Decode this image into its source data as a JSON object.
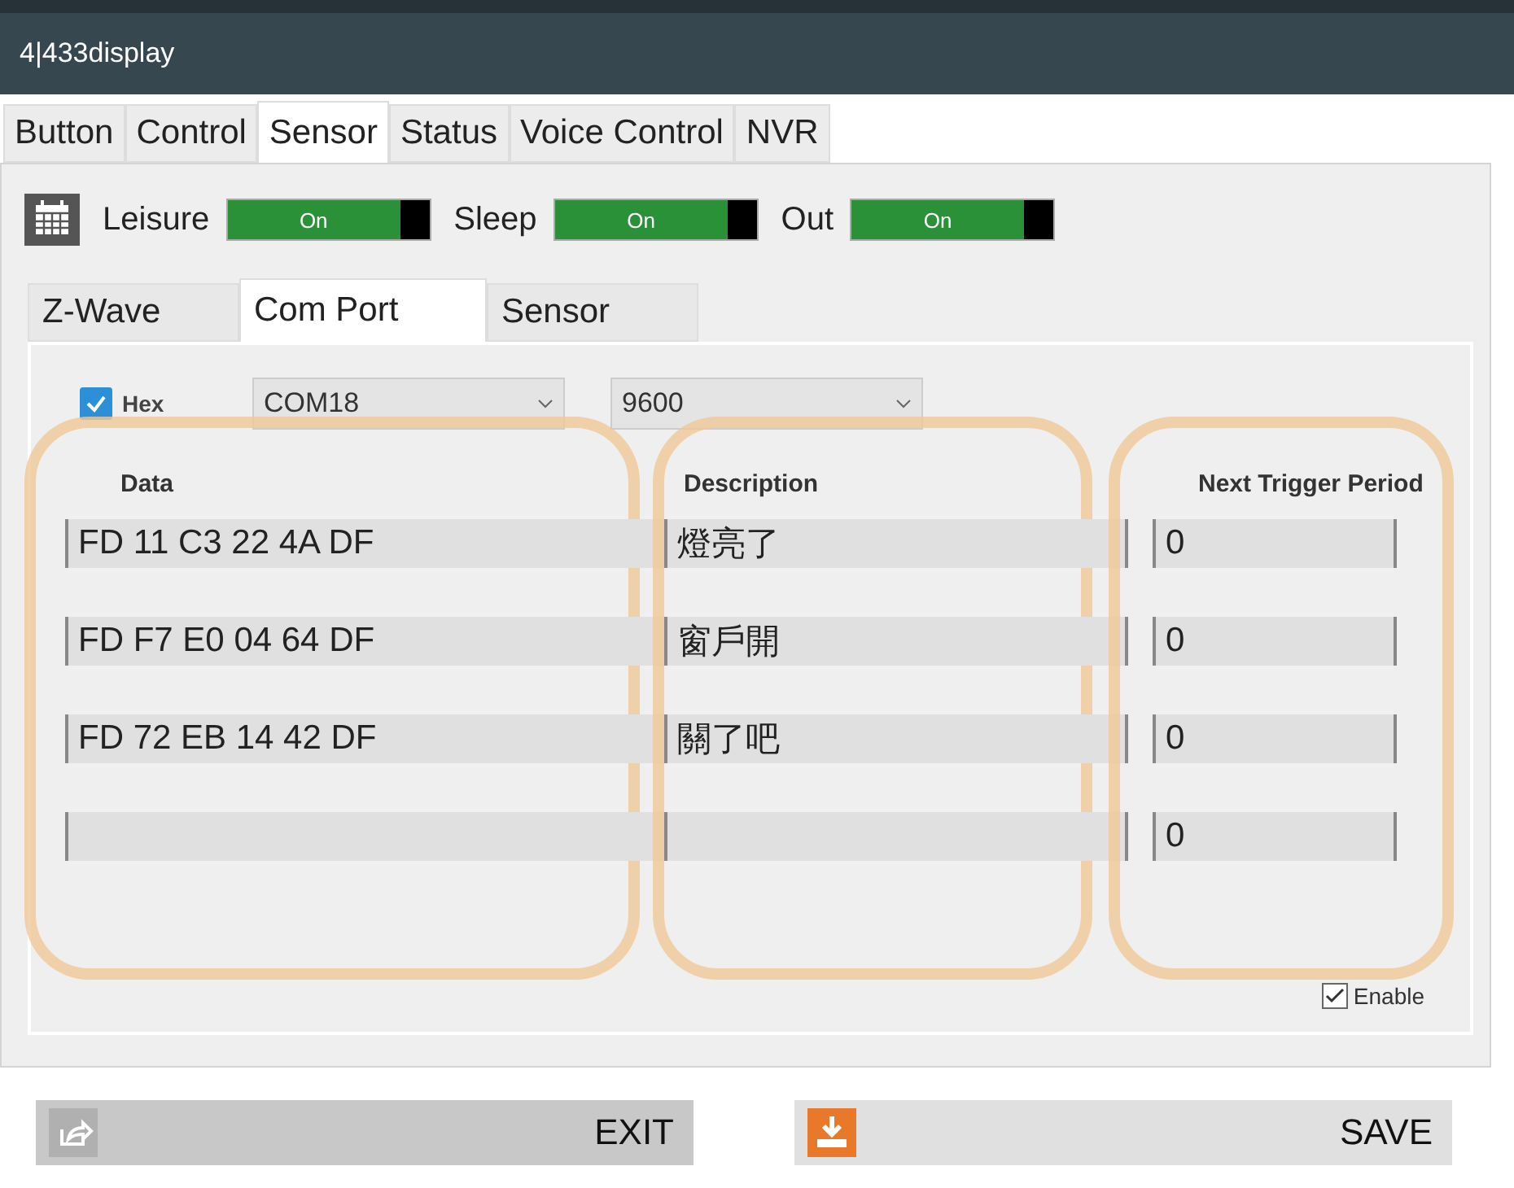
{
  "window": {
    "title": "4|433display"
  },
  "tabs": [
    {
      "label": "Button",
      "selected": false
    },
    {
      "label": "Control",
      "selected": false
    },
    {
      "label": "Sensor",
      "selected": true
    },
    {
      "label": "Status",
      "selected": false
    },
    {
      "label": "Voice Control",
      "selected": false
    },
    {
      "label": "NVR",
      "selected": false
    }
  ],
  "modes": [
    {
      "label": "Leisure",
      "on": true,
      "state": "On"
    },
    {
      "label": "Sleep",
      "on": true,
      "state": "On"
    },
    {
      "label": "Out",
      "on": true,
      "state": "On"
    }
  ],
  "sub_tabs": [
    {
      "label": "Z-Wave",
      "selected": false
    },
    {
      "label": "Com Port",
      "selected": true
    },
    {
      "label": "Sensor",
      "selected": false
    }
  ],
  "hex": {
    "label": "Hex",
    "checked": true
  },
  "port": {
    "value": "COM18"
  },
  "baud": {
    "value": "9600"
  },
  "table": {
    "columns": [
      "Data",
      "Description",
      "Next Trigger Period"
    ],
    "rows": [
      {
        "data": "FD 11 C3 22 4A DF",
        "description": "燈亮了",
        "period": "0"
      },
      {
        "data": "FD F7 E0 04 64 DF",
        "description": "窗戶開",
        "period": "0"
      },
      {
        "data": "FD 72 EB 14 42 DF",
        "description": "關了吧",
        "period": "0"
      },
      {
        "period": "0"
      }
    ]
  },
  "enable": {
    "label": "Enable",
    "checked": true
  },
  "buttons": [
    {
      "label": "EXIT",
      "kind": "exit"
    },
    {
      "label": "SAVE",
      "kind": "save"
    }
  ]
}
